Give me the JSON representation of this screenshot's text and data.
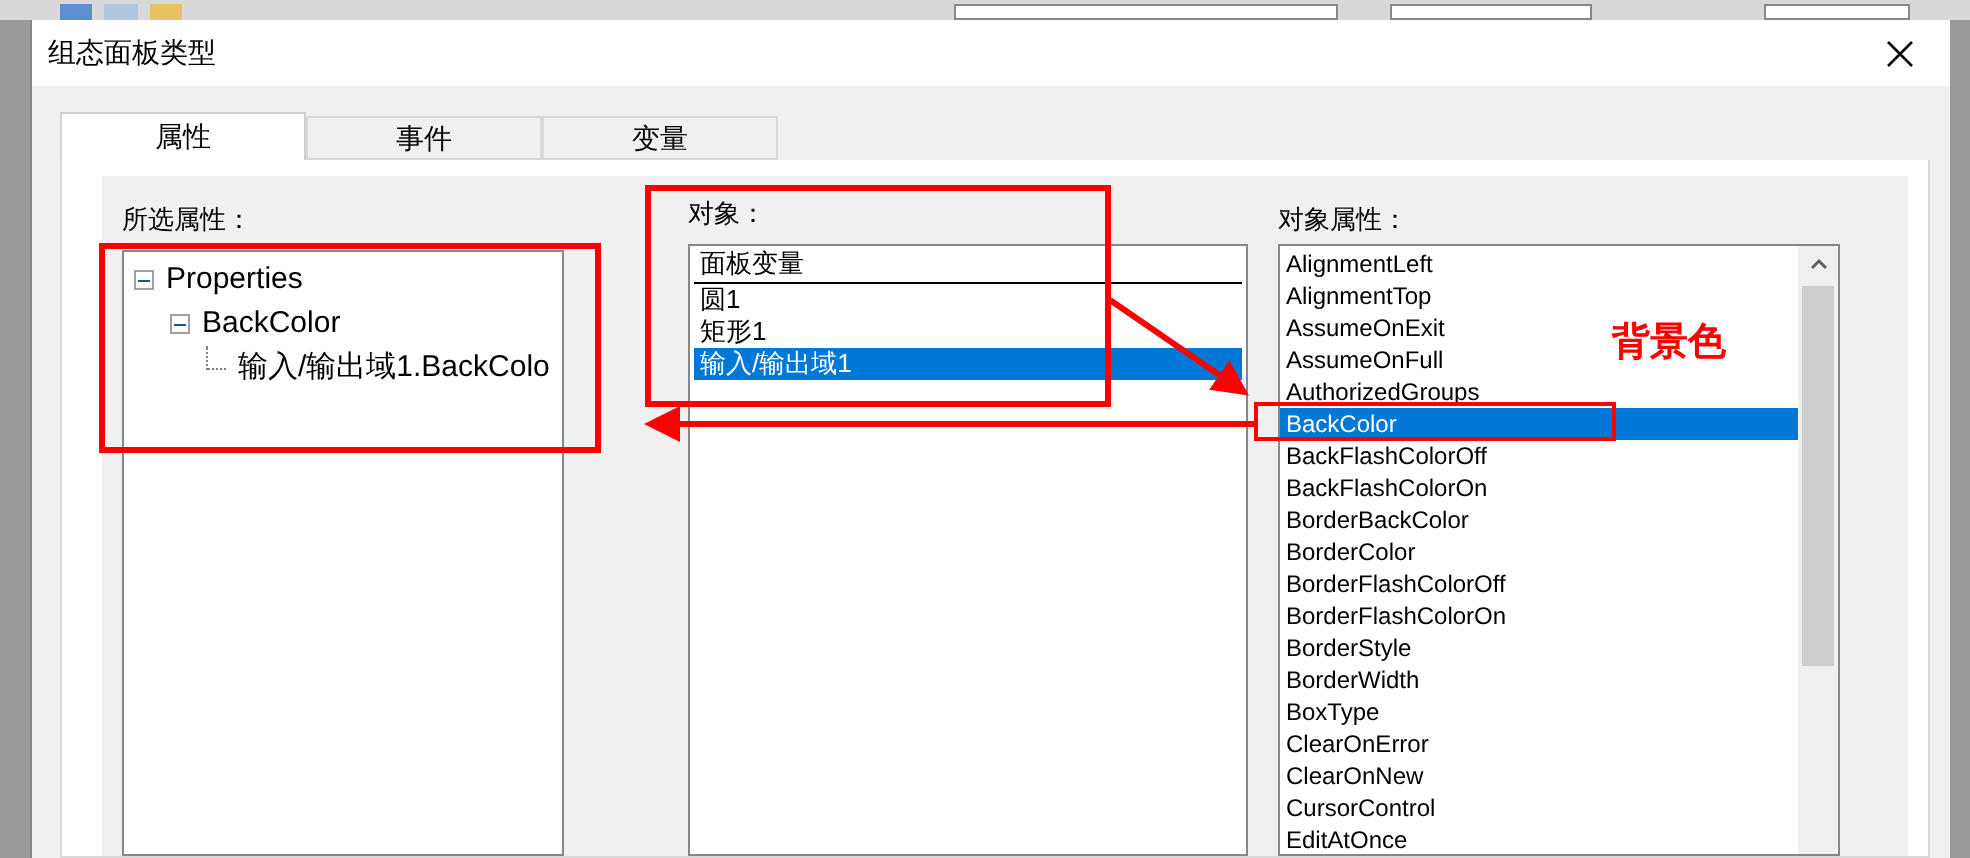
{
  "window": {
    "title": "组态面板类型"
  },
  "tabs": [
    {
      "label": "属性",
      "selected": true
    },
    {
      "label": "事件",
      "selected": false
    },
    {
      "label": "变量",
      "selected": false
    }
  ],
  "selected_properties": {
    "label": "所选属性：",
    "tree": [
      {
        "label": "Properties",
        "expanded": true,
        "children": [
          {
            "label": "BackColor",
            "expanded": true,
            "children": [
              {
                "label": "输入/输出域1.BackColo"
              }
            ]
          }
        ]
      }
    ]
  },
  "objects": {
    "label": "对象：",
    "header": "面板变量",
    "items": [
      {
        "label": "圆1",
        "selected": false
      },
      {
        "label": "矩形1",
        "selected": false
      },
      {
        "label": "输入/输出域1",
        "selected": true
      }
    ]
  },
  "object_properties": {
    "label": "对象属性：",
    "items": [
      {
        "label": "AlignmentLeft",
        "selected": false
      },
      {
        "label": "AlignmentTop",
        "selected": false
      },
      {
        "label": "AssumeOnExit",
        "selected": false
      },
      {
        "label": "AssumeOnFull",
        "selected": false
      },
      {
        "label": "AuthorizedGroups",
        "selected": false
      },
      {
        "label": "BackColor",
        "selected": true
      },
      {
        "label": "BackFlashColorOff",
        "selected": false
      },
      {
        "label": "BackFlashColorOn",
        "selected": false
      },
      {
        "label": "BorderBackColor",
        "selected": false
      },
      {
        "label": "BorderColor",
        "selected": false
      },
      {
        "label": "BorderFlashColorOff",
        "selected": false
      },
      {
        "label": "BorderFlashColorOn",
        "selected": false
      },
      {
        "label": "BorderStyle",
        "selected": false
      },
      {
        "label": "BorderWidth",
        "selected": false
      },
      {
        "label": "BoxType",
        "selected": false
      },
      {
        "label": "ClearOnError",
        "selected": false
      },
      {
        "label": "ClearOnNew",
        "selected": false
      },
      {
        "label": "CursorControl",
        "selected": false
      },
      {
        "label": "EditAtOnce",
        "selected": false
      }
    ]
  },
  "annotation": {
    "label": "背景色"
  }
}
